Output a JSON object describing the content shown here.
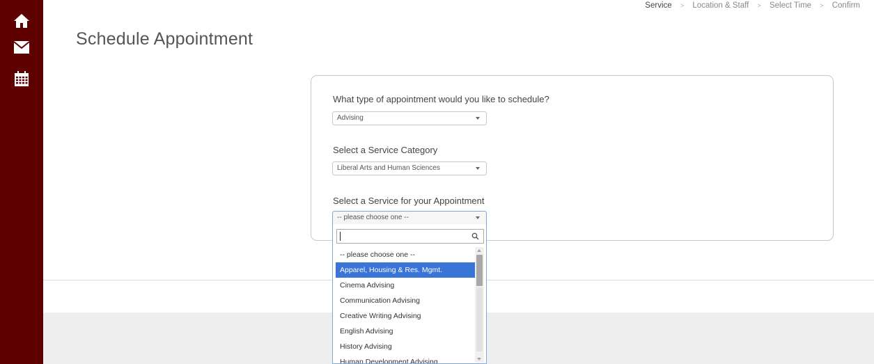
{
  "sidebar": {
    "items": [
      {
        "icon": "home-icon"
      },
      {
        "icon": "mail-icon"
      },
      {
        "icon": "calendar-icon"
      }
    ]
  },
  "steps": [
    "Service",
    "Location & Staff",
    "Select Time",
    "Confirm"
  ],
  "step_separator": ">",
  "page_title": "Schedule Appointment",
  "form": {
    "q1": {
      "label": "What type of appointment would you like to schedule?",
      "value": "Advising"
    },
    "q2": {
      "label": "Select a Service Category",
      "value": "Liberal Arts and Human Sciences"
    },
    "q3": {
      "label": "Select a Service for your Appointment",
      "value": "-- please choose one --"
    }
  },
  "dropdown": {
    "search_value": "",
    "options": [
      "-- please choose one --",
      "Apparel, Housing & Res. Mgmt.",
      "Cinema Advising",
      "Communication Advising",
      "Creative Writing Advising",
      "English Advising",
      "History Advising",
      "Human Development Advising"
    ],
    "highlighted": "Apparel, Housing & Res. Mgmt."
  },
  "colors": {
    "sidebar": "#5e0000",
    "highlight": "#3875d7"
  }
}
